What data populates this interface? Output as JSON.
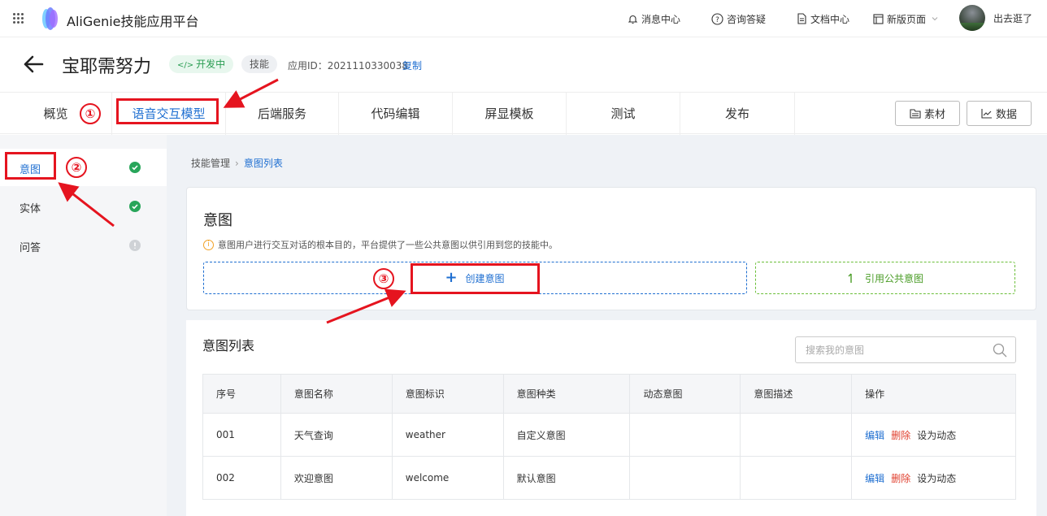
{
  "topbar": {
    "brand": "AliGenie技能应用平台",
    "nav": [
      {
        "label": "消息中心",
        "icon": "bell-icon"
      },
      {
        "label": "咨询答疑",
        "icon": "question-circle-icon"
      },
      {
        "label": "文档中心",
        "icon": "document-icon"
      },
      {
        "label": "新版页面",
        "icon": "layout-icon"
      }
    ],
    "logout": "出去逛了"
  },
  "project": {
    "name": "宝耶需努力",
    "status_tag": "开发中",
    "type_tag": "技能",
    "app_id": "应用ID：2021110330038",
    "copy": "复制"
  },
  "tabs": [
    "概览",
    "语音交互模型",
    "后端服务",
    "代码编辑",
    "屏显模板",
    "测试",
    "发布"
  ],
  "active_tab": "语音交互模型",
  "tab_buttons": {
    "materials": "素材",
    "data": "数据"
  },
  "sidebar": {
    "items": [
      {
        "label": "意图",
        "status": "ok"
      },
      {
        "label": "实体",
        "status": "ok"
      },
      {
        "label": "问答",
        "status": "pending"
      }
    ]
  },
  "breadcrumb": {
    "parent": "技能管理",
    "current": "意图列表"
  },
  "intent_card": {
    "title": "意图",
    "hint": "意图用户进行交互对话的根本目的，平台提供了一些公共意图以供引用到您的技能中。",
    "create": "创建意图",
    "reference": "引用公共意图"
  },
  "list": {
    "title": "意图列表",
    "search_placeholder": "搜索我的意图",
    "columns": [
      "序号",
      "意图名称",
      "意图标识",
      "意图种类",
      "动态意图",
      "意图描述",
      "操作"
    ],
    "rows": [
      {
        "no": "001",
        "name": "天气查询",
        "id": "weather",
        "kind": "自定义意图",
        "dynamic": "",
        "desc": ""
      },
      {
        "no": "002",
        "name": "欢迎意图",
        "id": "welcome",
        "kind": "默认意图",
        "dynamic": "",
        "desc": ""
      }
    ],
    "actions": {
      "edit": "编辑",
      "delete": "删除",
      "set_dynamic": "设为动态"
    }
  },
  "annotations": [
    "①",
    "②",
    "③"
  ],
  "colors": {
    "accent": "#1f6fd1",
    "success": "#28a55a",
    "danger": "#e0402f",
    "annotation": "#e5141f"
  }
}
